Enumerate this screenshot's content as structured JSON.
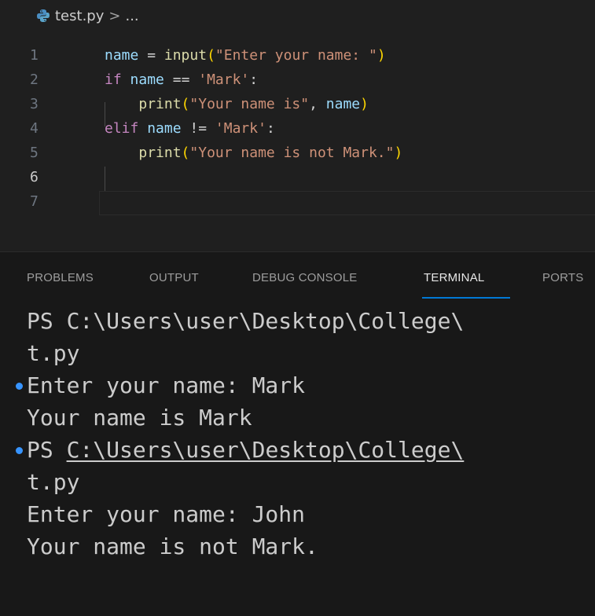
{
  "breadcrumb": {
    "file": "test.py",
    "separator": ">",
    "more": "..."
  },
  "editor": {
    "line_numbers": [
      "1",
      "2",
      "3",
      "4",
      "5",
      "6",
      "7"
    ],
    "active_line": "6",
    "lines": [
      [
        {
          "t": "name",
          "c": "var"
        },
        {
          "t": " = ",
          "c": "op"
        },
        {
          "t": "input",
          "c": "fn"
        },
        {
          "t": "(",
          "c": "b1"
        },
        {
          "t": "\"Enter your name: \"",
          "c": "str"
        },
        {
          "t": ")",
          "c": "b1"
        }
      ],
      [
        {
          "t": "if",
          "c": "kw-ctrl"
        },
        {
          "t": " ",
          "c": "op"
        },
        {
          "t": "name",
          "c": "var"
        },
        {
          "t": " == ",
          "c": "op"
        },
        {
          "t": "'Mark'",
          "c": "str"
        },
        {
          "t": ":",
          "c": "op"
        }
      ],
      [
        {
          "t": "    ",
          "c": "op"
        },
        {
          "t": "print",
          "c": "fn"
        },
        {
          "t": "(",
          "c": "b1"
        },
        {
          "t": "\"Your name is\"",
          "c": "str"
        },
        {
          "t": ", ",
          "c": "op"
        },
        {
          "t": "name",
          "c": "var"
        },
        {
          "t": ")",
          "c": "b1"
        }
      ],
      [
        {
          "t": "elif",
          "c": "kw-ctrl"
        },
        {
          "t": " ",
          "c": "op"
        },
        {
          "t": "name",
          "c": "var"
        },
        {
          "t": " != ",
          "c": "op"
        },
        {
          "t": "'Mark'",
          "c": "str"
        },
        {
          "t": ":",
          "c": "op"
        }
      ],
      [
        {
          "t": "    ",
          "c": "op"
        },
        {
          "t": "print",
          "c": "fn"
        },
        {
          "t": "(",
          "c": "b1"
        },
        {
          "t": "\"Your name is not Mark.\"",
          "c": "str"
        },
        {
          "t": ")",
          "c": "b1"
        }
      ],
      [],
      []
    ]
  },
  "panel": {
    "tabs": [
      "PROBLEMS",
      "OUTPUT",
      "DEBUG CONSOLE",
      "TERMINAL",
      "PORTS"
    ],
    "active_tab": "TERMINAL"
  },
  "terminal": {
    "lines": [
      {
        "text": "PS C:\\Users\\user\\Desktop\\College\\",
        "marker": false
      },
      {
        "text": "t.py",
        "marker": false
      },
      {
        "text": "Enter your name: Mark",
        "marker": true
      },
      {
        "text": "Your name is Mark",
        "marker": false
      },
      {
        "prefix": "PS ",
        "text": "C:\\Users\\user\\Desktop\\College\\",
        "marker": true,
        "underline": true
      },
      {
        "text": "t.py",
        "marker": false
      },
      {
        "text": "Enter your name: John",
        "marker": false
      },
      {
        "text": "Your name is not Mark.",
        "marker": false
      }
    ]
  },
  "colors": {
    "accent": "#0078d4",
    "decoration_marker": "#3794ff"
  }
}
